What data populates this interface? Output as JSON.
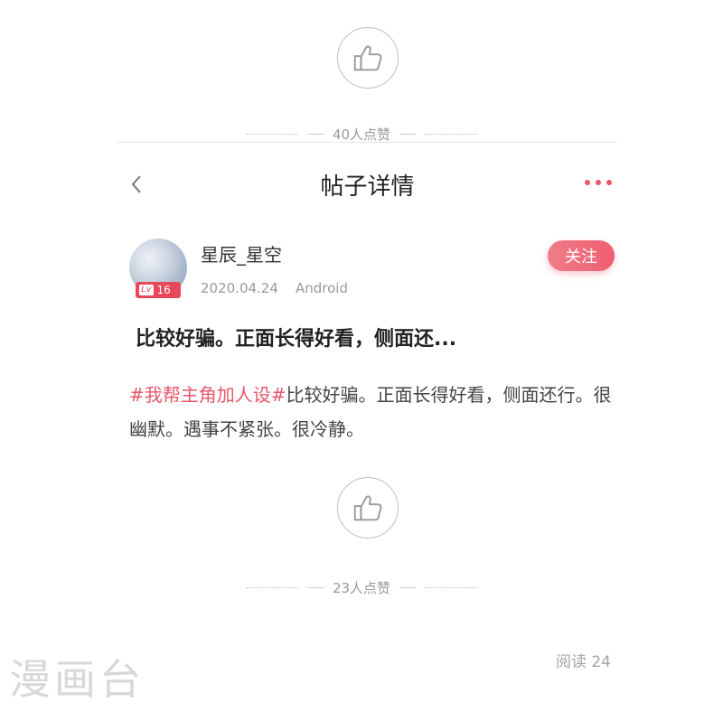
{
  "top_like": {
    "count_text": "40人点赞",
    "icon": "thumbs-up-icon"
  },
  "header": {
    "title": "帖子详情",
    "back_icon": "chevron-left-icon",
    "more_icon": "more-dots-icon",
    "accent": "#e8566b"
  },
  "author": {
    "name": "星辰_星空",
    "level_prefix": "Lv",
    "level": "16",
    "date": "2020.04.24",
    "device": "Android",
    "follow_label": "关注"
  },
  "post": {
    "title": "比较好骗。正面长得好看，侧面还...",
    "topic": "#我帮主角加人设#",
    "body": "比较好骗。正面长得好看，侧面还行。很幽默。遇事不紧张。很冷静。"
  },
  "bottom_like": {
    "count_text": "23人点赞",
    "icon": "thumbs-up-icon"
  },
  "read_count": "阅读 24",
  "watermark": "漫画台"
}
